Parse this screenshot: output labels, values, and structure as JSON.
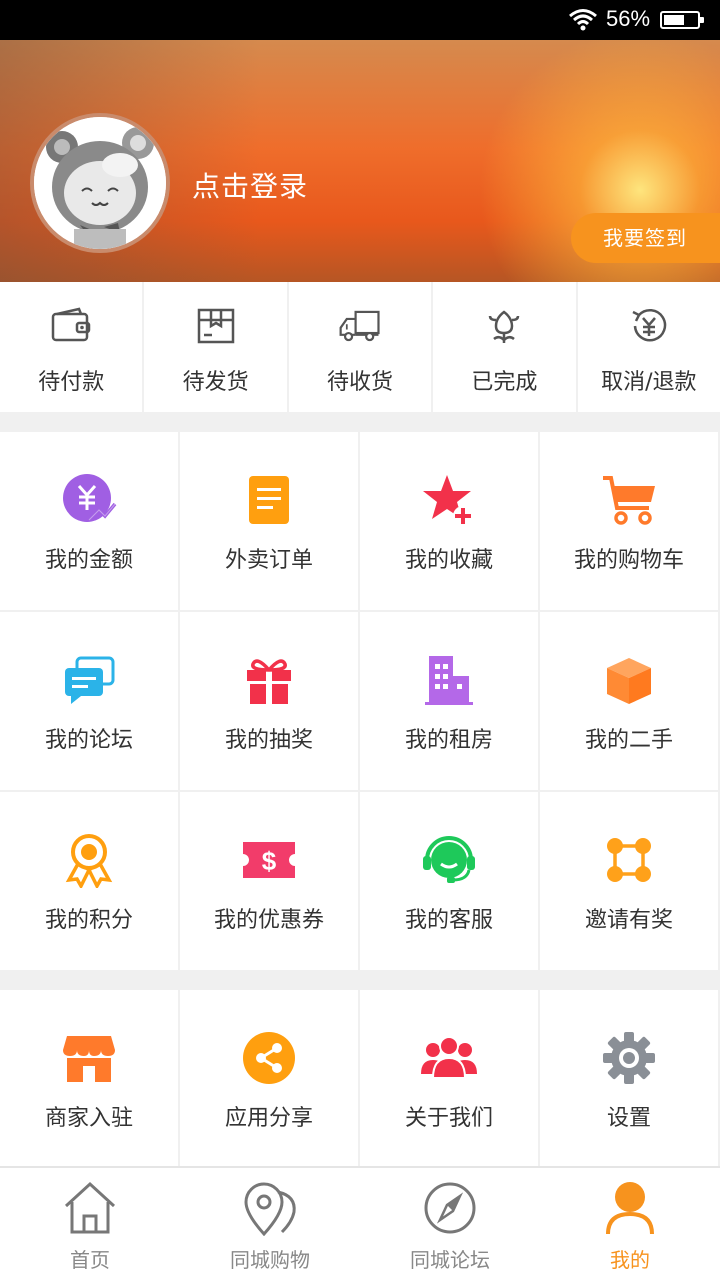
{
  "status_bar": {
    "battery": "56%",
    "icons": [
      "wifi-icon",
      "battery-icon"
    ]
  },
  "header": {
    "login_text": "点击登录",
    "checkin_label": "我要签到",
    "avatar": "cartoon-bear-avatar"
  },
  "orders": [
    {
      "label": "待付款",
      "icon": "wallet-icon"
    },
    {
      "label": "待发货",
      "icon": "package-box-icon"
    },
    {
      "label": "待收货",
      "icon": "delivery-truck-icon"
    },
    {
      "label": "已完成",
      "icon": "flower-icon"
    },
    {
      "label": "取消/退款",
      "icon": "refund-yuan-icon"
    }
  ],
  "menu": [
    {
      "label": "我的金额",
      "icon": "money-yuan-icon",
      "color": "#a05fe3"
    },
    {
      "label": "外卖订单",
      "icon": "order-document-icon",
      "color": "#ff9f0f"
    },
    {
      "label": "我的收藏",
      "icon": "star-plus-icon",
      "color": "#f2314a"
    },
    {
      "label": "我的购物车",
      "icon": "shopping-cart-icon",
      "color": "#ff7a2b"
    },
    {
      "label": "我的论坛",
      "icon": "chat-bubbles-icon",
      "color": "#2bb3e8"
    },
    {
      "label": "我的抽奖",
      "icon": "gift-icon",
      "color": "#f2314a"
    },
    {
      "label": "我的租房",
      "icon": "building-icon",
      "color": "#b468e8"
    },
    {
      "label": "我的二手",
      "icon": "cube-box-icon",
      "color": "#ff8a34"
    },
    {
      "label": "我的积分",
      "icon": "award-ribbon-icon",
      "color": "#ff9f0f"
    },
    {
      "label": "我的优惠券",
      "icon": "coupon-dollar-icon",
      "color": "#f23c6a"
    },
    {
      "label": "我的客服",
      "icon": "headset-icon",
      "color": "#1ec95a"
    },
    {
      "label": "邀请有奖",
      "icon": "invite-nodes-icon",
      "color": "#ffa11a"
    }
  ],
  "menu2": [
    {
      "label": "商家入驻",
      "icon": "storefront-icon",
      "color": "#ff7a2b"
    },
    {
      "label": "应用分享",
      "icon": "share-icon",
      "color": "#ff9f0f"
    },
    {
      "label": "关于我们",
      "icon": "group-people-icon",
      "color": "#f2314a"
    },
    {
      "label": "设置",
      "icon": "gear-icon",
      "color": "#8a8f96"
    }
  ],
  "bottom_nav": [
    {
      "label": "首页",
      "icon": "home-icon",
      "active": false
    },
    {
      "label": "同城购物",
      "icon": "location-map-icon",
      "active": false
    },
    {
      "label": "同城论坛",
      "icon": "compass-icon",
      "active": false
    },
    {
      "label": "我的",
      "icon": "user-profile-icon",
      "active": true
    }
  ],
  "colors": {
    "accent": "#f7931e",
    "separator": "#f0f0f0",
    "text": "#333333"
  }
}
